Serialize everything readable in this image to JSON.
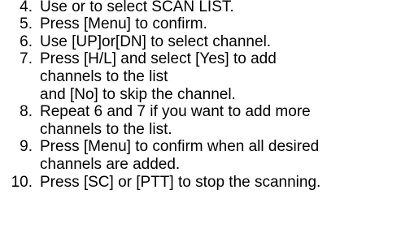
{
  "document": {
    "steps": [
      {
        "number": "4.",
        "lines": [
          "Use or to select SCAN LIST."
        ]
      },
      {
        "number": "5.",
        "lines": [
          "Press [Menu] to confirm."
        ]
      },
      {
        "number": "6.",
        "lines": [
          "Use [UP]or[DN] to select channel."
        ]
      },
      {
        "number": "7.",
        "lines": [
          "Press [H/L] and select [Yes] to add",
          "channels to the list",
          "and [No] to skip the channel."
        ]
      },
      {
        "number": "8.",
        "lines": [
          "Repeat 6 and 7 if you want to add more",
          "channels to the list."
        ]
      },
      {
        "number": "9.",
        "lines": [
          "Press [Menu] to confirm when all desired",
          "channels are added."
        ]
      },
      {
        "number": "10.",
        "lines": [
          "Press [SC] or [PTT] to stop the scanning."
        ]
      }
    ]
  }
}
